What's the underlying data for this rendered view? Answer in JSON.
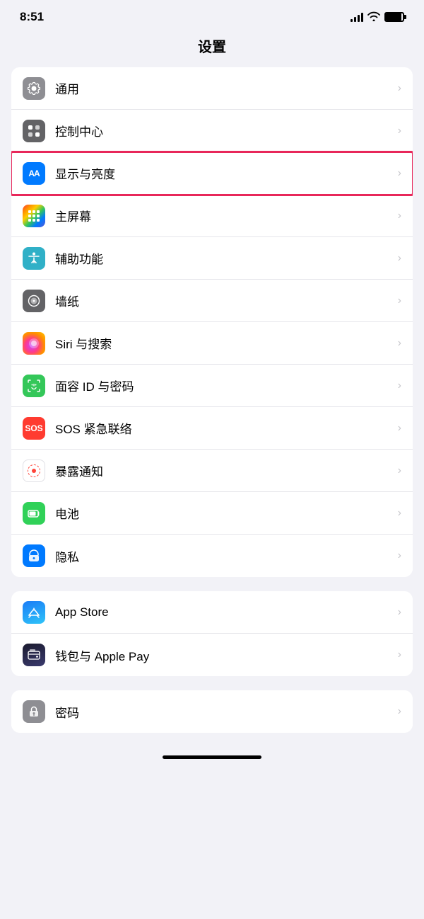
{
  "statusBar": {
    "time": "8:51",
    "ariaLabel": "Status bar"
  },
  "pageTitle": "设置",
  "groups": [
    {
      "id": "group1",
      "items": [
        {
          "id": "general",
          "iconType": "gear",
          "iconBg": "bg-gray",
          "label": "通用",
          "highlighted": false
        },
        {
          "id": "controlCenter",
          "iconType": "toggle",
          "iconBg": "bg-gray-dark",
          "label": "控制中心",
          "highlighted": false
        },
        {
          "id": "display",
          "iconType": "aa",
          "iconBg": "bg-blue",
          "label": "显示与亮度",
          "highlighted": true
        },
        {
          "id": "homeScreen",
          "iconType": "grid",
          "iconBg": "bg-multicolor",
          "label": "主屏幕",
          "highlighted": false
        },
        {
          "id": "accessibility",
          "iconType": "accessibility",
          "iconBg": "bg-teal",
          "label": "辅助功能",
          "highlighted": false
        },
        {
          "id": "wallpaper",
          "iconType": "flower",
          "iconBg": "bg-gray",
          "label": "墙纸",
          "highlighted": false
        },
        {
          "id": "siri",
          "iconType": "siri",
          "iconBg": "bg-siri",
          "label": "Siri 与搜索",
          "highlighted": false
        },
        {
          "id": "faceId",
          "iconType": "faceid",
          "iconBg": "bg-faceid",
          "label": "面容 ID 与密码",
          "highlighted": false
        },
        {
          "id": "sos",
          "iconType": "sos",
          "iconBg": "bg-red",
          "label": "SOS 紧急联络",
          "highlighted": false
        },
        {
          "id": "exposure",
          "iconType": "exposure",
          "iconBg": "bg-exposure",
          "label": "暴露通知",
          "highlighted": false
        },
        {
          "id": "battery",
          "iconType": "battery",
          "iconBg": "bg-green-dark",
          "label": "电池",
          "highlighted": false
        },
        {
          "id": "privacy",
          "iconType": "hand",
          "iconBg": "bg-privacy",
          "label": "隐私",
          "highlighted": false
        }
      ]
    },
    {
      "id": "group2",
      "items": [
        {
          "id": "appStore",
          "iconType": "appstore",
          "iconBg": "bg-appstore",
          "label": "App Store",
          "highlighted": false
        },
        {
          "id": "wallet",
          "iconType": "wallet",
          "iconBg": "bg-wallet",
          "label": "钱包与 Apple Pay",
          "highlighted": false
        }
      ]
    },
    {
      "id": "group3",
      "items": [
        {
          "id": "passwords",
          "iconType": "key",
          "iconBg": "bg-keychain",
          "label": "密码",
          "highlighted": false
        }
      ]
    }
  ],
  "chevron": "›"
}
